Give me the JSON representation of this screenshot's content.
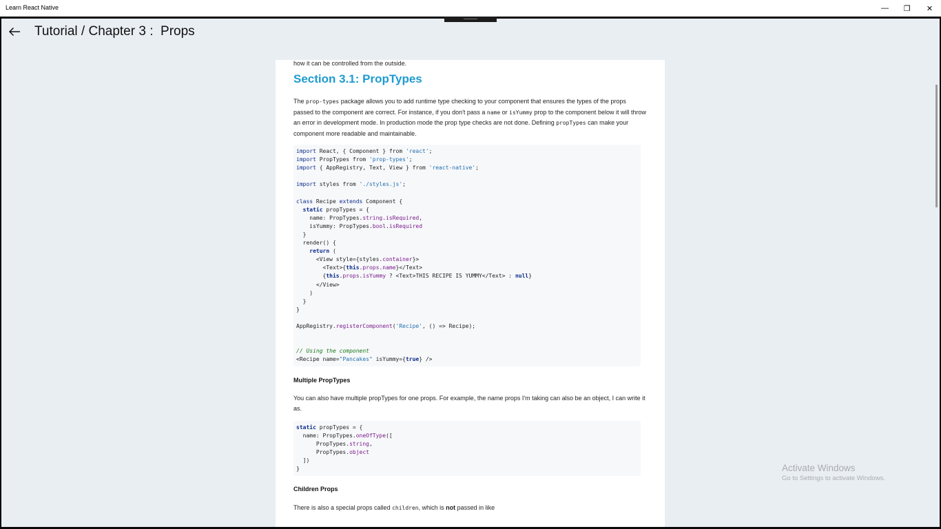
{
  "window": {
    "title": "Learn React Native",
    "minimize_glyph": "—",
    "maximize_glyph": "❐",
    "close_glyph": "✕"
  },
  "header": {
    "back_icon": "arrow-left-icon",
    "title": "Tutorial / Chapter 3 :  Props"
  },
  "content": {
    "intro_tail": "how it can be controlled from the outside.",
    "section_title": "Section 3.1: PropTypes",
    "para1": {
      "t1": "The ",
      "c1": "prop-types",
      "t2": " package allows you to add runtime type checking to your component that ensures the types of the props passed to the component are correct. For instance, if you don't pass a ",
      "c2": "name",
      "t3": " or ",
      "c3": "isYummy",
      "t4": " prop to the component below it will throw an error in development mode. In production mode the prop type checks are not done. Defining ",
      "c4": "propTypes",
      "t5": " can make your component more readable and maintainable."
    },
    "code1": {
      "l1a": "import",
      "l1b": " React, { Component } from ",
      "l1c": "'react'",
      "l1d": ";",
      "l2a": "import",
      "l2b": " PropTypes from ",
      "l2c": "'prop-types'",
      "l2d": ";",
      "l3a": "import",
      "l3b": " { AppRegistry, Text, View } from ",
      "l3c": "'react-native'",
      "l3d": ";",
      "l4a": "import",
      "l4b": " styles from ",
      "l4c": "'./styles.js'",
      "l4d": ";",
      "l5a": "class",
      "l5b": " Recipe ",
      "l5c": "extends",
      "l5d": " Component {",
      "l6a": "  ",
      "l6b": "static",
      "l6c": " propTypes = {",
      "l7a": "    name: PropTypes.",
      "l7b": "string",
      "l7c": ".",
      "l7d": "isRequired",
      "l7e": ",",
      "l8a": "    isYummy: PropTypes.",
      "l8b": "bool",
      "l8c": ".",
      "l8d": "isRequired",
      "l9": "  }",
      "l10": "  render() {",
      "l11a": "    ",
      "l11b": "return",
      "l11c": " (",
      "l12a": "      <View style={styles.",
      "l12b": "container",
      "l12c": "}>",
      "l13a": "        <Text>{",
      "l13b": "this",
      "l13c": ".",
      "l13d": "props",
      "l13e": ".",
      "l13f": "name",
      "l13g": "}</Text>",
      "l14a": "        {",
      "l14b": "this",
      "l14c": ".",
      "l14d": "props",
      "l14e": ".",
      "l14f": "isYummy",
      "l14g": " ? <Text>THIS RECIPE IS YUMMY</Text> : ",
      "l14h": "null",
      "l14i": "}",
      "l15": "      </View>",
      "l16": "    )",
      "l17": "  }",
      "l18": "}",
      "l19a": "AppRegistry.",
      "l19b": "registerComponent",
      "l19c": "(",
      "l19d": "'Recipe'",
      "l19e": ", () => Recipe);",
      "l20": "// Using the component",
      "l21a": "<Recipe name=",
      "l21b": "\"Pancakes\"",
      "l21c": " isYummy={",
      "l21d": "true",
      "l21e": "} />"
    },
    "subhead1": "Multiple PropTypes",
    "para2": "You can also have multiple propTypes for one props. For example, the name props I'm taking can also be an object, I can write it as.",
    "code2": {
      "l1a": "static",
      "l1b": " propTypes = {",
      "l2a": "  name: PropTypes.",
      "l2b": "oneOfType",
      "l2c": "([",
      "l3a": "      PropTypes.",
      "l3b": "string",
      "l3c": ",",
      "l4a": "      PropTypes.",
      "l4b": "object",
      "l5": "  ])",
      "l6": "}"
    },
    "subhead2": "Children Props",
    "para3": {
      "t1": "There is also a special props called ",
      "c1": "children",
      "t2": ", which is ",
      "b1": "not",
      "t3": " passed in like"
    }
  },
  "watermark": {
    "line1": "Activate Windows",
    "line2": "Go to Settings to activate Windows."
  }
}
